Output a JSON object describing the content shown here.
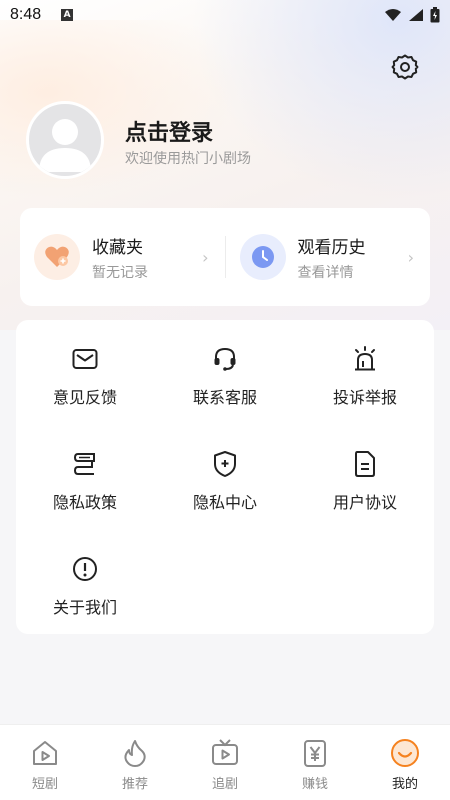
{
  "status_bar": {
    "time": "8:48",
    "notification_glyph": "A"
  },
  "profile": {
    "login_title": "点击登录",
    "login_subtitle": "欢迎使用热门小剧场"
  },
  "quick_cards": [
    {
      "title": "收藏夹",
      "subtitle": "暂无记录",
      "icon": "heart-icon",
      "icon_color": "#f2a273"
    },
    {
      "title": "观看历史",
      "subtitle": "查看详情",
      "icon": "clock-icon",
      "icon_color": "#6f8ef0"
    }
  ],
  "menu": [
    {
      "label": "意见反馈",
      "icon": "mail-icon"
    },
    {
      "label": "联系客服",
      "icon": "headset-icon"
    },
    {
      "label": "投诉举报",
      "icon": "alarm-icon"
    },
    {
      "label": "隐私政策",
      "icon": "policy-icon"
    },
    {
      "label": "隐私中心",
      "icon": "shield-icon"
    },
    {
      "label": "用户协议",
      "icon": "document-icon"
    },
    {
      "label": "关于我们",
      "icon": "info-icon"
    }
  ],
  "tabs": [
    {
      "label": "短剧",
      "icon": "home-play-icon",
      "active": false
    },
    {
      "label": "推荐",
      "icon": "flame-icon",
      "active": false
    },
    {
      "label": "追剧",
      "icon": "tv-icon",
      "active": false
    },
    {
      "label": "赚钱",
      "icon": "yen-icon",
      "active": false
    },
    {
      "label": "我的",
      "icon": "smile-icon",
      "active": true
    }
  ],
  "colors": {
    "accent": "#f5821f",
    "text_primary": "#1a1a1a",
    "text_secondary": "#9a9a9a"
  }
}
